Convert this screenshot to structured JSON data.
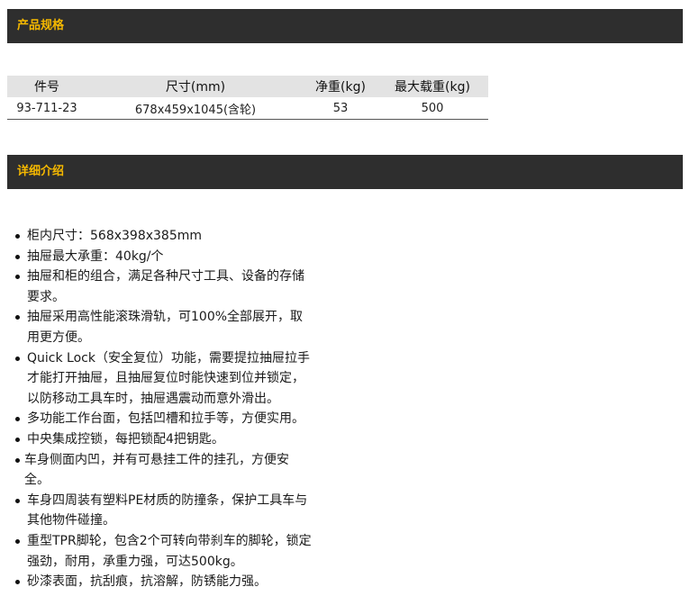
{
  "sections": {
    "spec_title": "产品规格",
    "detail_title": "详细介绍"
  },
  "spec_table": {
    "headers": [
      "件号",
      "尺寸(mm)",
      "净重(kg)",
      "最大载重(kg)"
    ],
    "rows": [
      [
        "93-711-23",
        "678x459x1045(含轮)",
        "53",
        "500"
      ]
    ]
  },
  "features": [
    "柜内尺寸：568x398x385mm",
    "抽屉最大承重：40kg/个",
    "抽屉和柜的组合，满足各种尺寸工具、设备的存储要求。",
    "抽屉采用高性能滚珠滑轨，可100%全部展开，取用更方便。",
    "Quick Lock（安全复位）功能，需要提拉抽屉拉手才能打开抽屉，且抽屉复位时能快速到位并锁定，以防移动工具车时，抽屉遇震动而意外滑出。",
    "多功能工作台面，包括凹槽和拉手等，方便实用。",
    "中央集成控锁，每把锁配4把钥匙。",
    "车身侧面内凹，并有可悬挂工件的挂孔，方便安全。",
    "车身四周装有塑料PE材质的防撞条，保护工具车与其他物件碰撞。",
    "重型TPR脚轮，包含2个可转向带刹车的脚轮，锁定强劲，耐用，承重力强，可达500kg。",
    "砂漆表面，抗刮痕，抗溶解，防锈能力强。"
  ]
}
